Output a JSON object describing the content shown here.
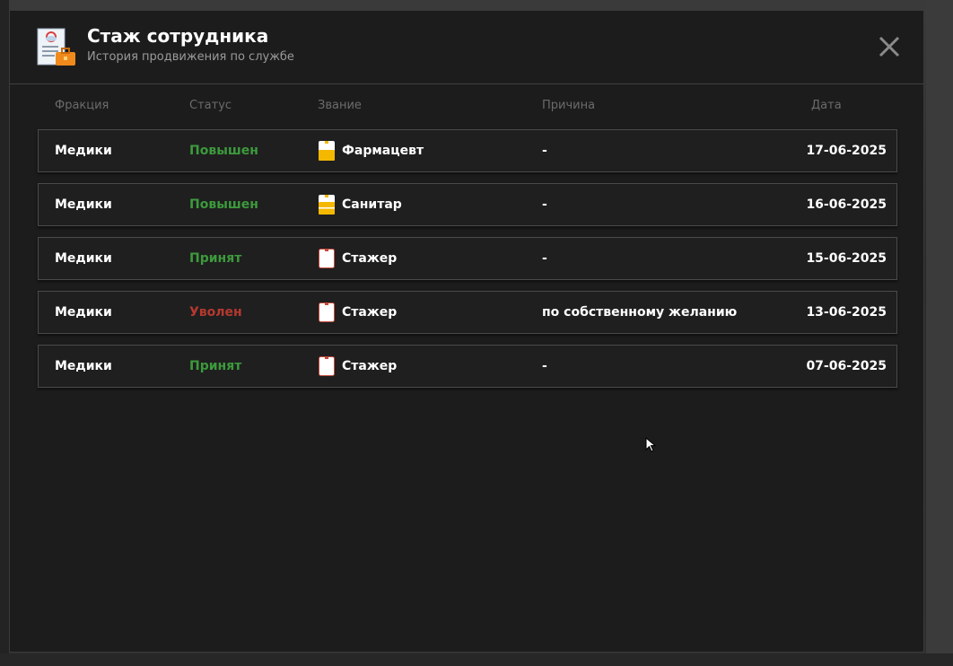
{
  "dialog": {
    "title": "Стаж сотрудника",
    "subtitle": "История продвижения по службе",
    "icon": "employee-record-icon",
    "close_icon": "close-icon"
  },
  "columns": [
    "Фракция",
    "Статус",
    "Звание",
    "Причина",
    "Дата"
  ],
  "colors": {
    "promoted": "#3c9a3c",
    "accepted": "#3c9a3c",
    "fired": "#b5392f",
    "rank_badge_high": "#f5b800"
  },
  "rows": [
    {
      "faction": "Медики",
      "status": "Повышен",
      "status_kind": "promoted",
      "rank_icon": "rank-badge-filled-icon",
      "rank": "Фармацевт",
      "reason": "-",
      "date": "17-06-2025"
    },
    {
      "faction": "Медики",
      "status": "Повышен",
      "status_kind": "promoted",
      "rank_icon": "rank-badge-filled-icon",
      "rank": "Санитар",
      "reason": "-",
      "date": "16-06-2025"
    },
    {
      "faction": "Медики",
      "status": "Принят",
      "status_kind": "accepted",
      "rank_icon": "rank-badge-empty-icon",
      "rank": "Стажер",
      "reason": "-",
      "date": "15-06-2025"
    },
    {
      "faction": "Медики",
      "status": "Уволен",
      "status_kind": "fired",
      "rank_icon": "rank-badge-empty-icon",
      "rank": "Стажер",
      "reason": "по собственному желанию",
      "date": "13-06-2025"
    },
    {
      "faction": "Медики",
      "status": "Принят",
      "status_kind": "accepted",
      "rank_icon": "rank-badge-empty-icon",
      "rank": "Стажер",
      "reason": "-",
      "date": "07-06-2025"
    }
  ]
}
